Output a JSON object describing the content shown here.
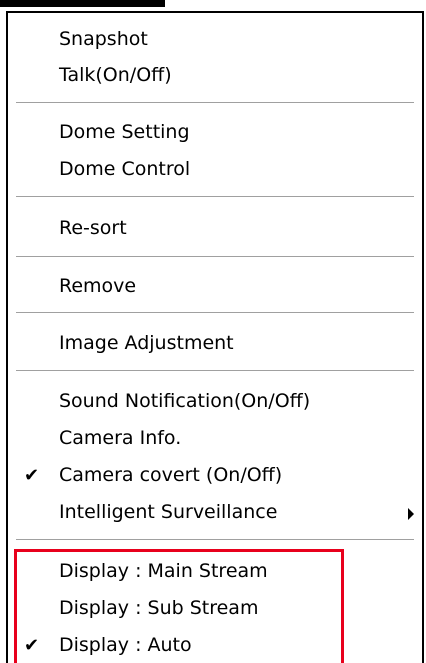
{
  "menu": {
    "items": {
      "snapshot": "Snapshot",
      "talk": "Talk(On/Off)",
      "dome_setting": "Dome Setting",
      "dome_control": "Dome Control",
      "resort": "Re-sort",
      "remove": "Remove",
      "image_adjustment": "Image Adjustment",
      "sound_notification": "Sound Notification(On/Off)",
      "camera_info": "Camera Info.",
      "camera_covert": "Camera covert (On/Off)",
      "intelligent_surveillance": "Intelligent Surveillance",
      "display_main": "Display : Main Stream",
      "display_sub": "Display : Sub Stream",
      "display_auto": "Display : Auto"
    },
    "check_glyph": "✔",
    "checked": {
      "camera_covert": true,
      "display_auto": true
    },
    "icons": {
      "check": "check-icon",
      "submenu_arrow": "submenu-arrow-icon"
    }
  },
  "highlight": {
    "color": "#e8001c",
    "target_group": "display-stream-options"
  }
}
